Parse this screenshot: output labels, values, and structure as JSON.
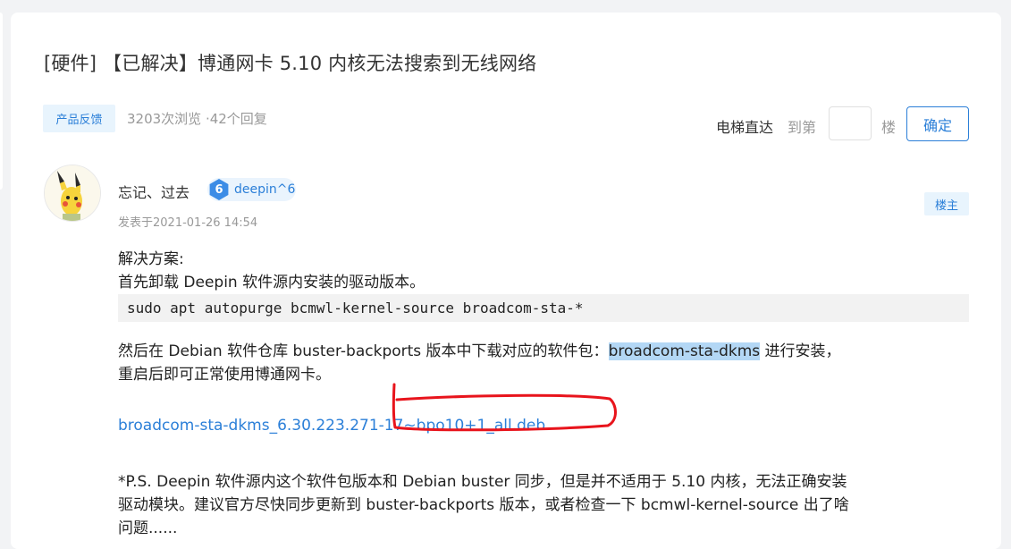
{
  "post": {
    "title": "[硬件] 【已解决】博通网卡 5.10 内核无法搜索到无线网络",
    "category_tag": "产品反馈",
    "stats": "3203次浏览 ·42个回复"
  },
  "jump": {
    "label": "电梯直达",
    "prefix": "到第",
    "input_value": "",
    "suffix": "楼",
    "confirm_label": "确定"
  },
  "author": {
    "name": "忘记、过去",
    "level_number": "6",
    "level_name": "deepin^6",
    "posted_at": "发表于2021-01-26 14:54",
    "op_badge": "楼主"
  },
  "content": {
    "solution_heading": "解决方案:",
    "step1": "首先卸载 Deepin 软件源内安装的驱动版本。",
    "command": "sudo apt autopurge bcmwl-kernel-source broadcom-sta-*",
    "step2_before": "然后在 Debian 软件仓库 buster-backports 版本中下载对应的软件包：",
    "step2_highlight": "broadcom-sta-dkms",
    "step2_after": " 进行安装，",
    "step2_line2": "重启后即可正常使用博通网卡。",
    "download_link": "broadcom-sta-dkms_6.30.223.271-17~bpo10+1_all.deb",
    "ps_line1": "*P.S. Deepin 软件源内这个软件包版本和 Debian buster 同步，但是并不适用于 5.10 内核，无法正确安装",
    "ps_line2": "驱动模块。建议官方尽快同步更新到 buster-backports 版本，或者检查一下 bcmwl-kernel-source 出了啥",
    "ps_line3": "问题......"
  },
  "colors": {
    "accent": "#2b7fd8",
    "tag_bg": "#e8f4fd",
    "annotation": "#e8141c",
    "highlight": "#b3d7f5"
  }
}
